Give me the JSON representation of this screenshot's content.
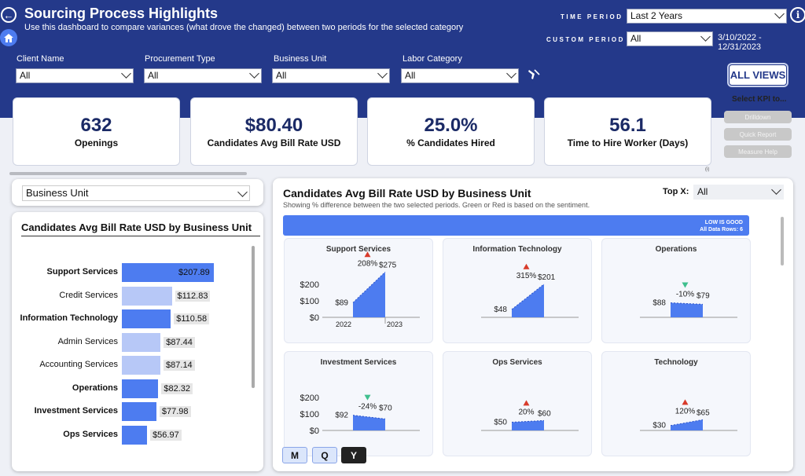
{
  "header": {
    "title": "Sourcing Process Highlights",
    "subtitle": "Use this dashboard to compare variances (what drove the changed) between two periods for the selected category",
    "time_period_label": "TIME PERIOD",
    "time_period_value": "Last 2 Years",
    "custom_period_label": "CUSTOM PERIOD",
    "custom_period_value": "All",
    "date_range": "3/10/2022 - 12/31/2023",
    "all_views": "ALL VIEWS"
  },
  "filters": [
    {
      "label": "Client Name",
      "value": "All"
    },
    {
      "label": "Procurement Type",
      "value": "All"
    },
    {
      "label": "Business Unit",
      "value": "All"
    },
    {
      "label": "Labor Category",
      "value": "All"
    }
  ],
  "kpis": [
    {
      "value": "632",
      "label": "Openings"
    },
    {
      "value": "$80.40",
      "label": "Candidates Avg Bill Rate USD"
    },
    {
      "value": "25.0%",
      "label": "% Candidates Hired"
    },
    {
      "value": "56.1",
      "label": "Time to Hire Worker (Days)"
    }
  ],
  "kpi_actions": {
    "title": "Select KPI to...",
    "buttons": [
      "Drilldown",
      "Quick Report",
      "Measure Help"
    ],
    "note": "(i)"
  },
  "left_panel": {
    "dimension_select": "Business Unit",
    "title": "Candidates Avg Bill Rate USD by Business Unit",
    "rows": [
      {
        "category": "Support Services",
        "value": 207.89,
        "label": "$207.89",
        "bold": true
      },
      {
        "category": "Credit Services",
        "value": 112.83,
        "label": "$112.83",
        "bold": false
      },
      {
        "category": "Information Technology",
        "value": 110.58,
        "label": "$110.58",
        "bold": true
      },
      {
        "category": "Admin Services",
        "value": 87.44,
        "label": "$87.44",
        "bold": false
      },
      {
        "category": "Accounting Services",
        "value": 87.14,
        "label": "$87.14",
        "bold": false
      },
      {
        "category": "Operations",
        "value": 82.32,
        "label": "$82.32",
        "bold": true
      },
      {
        "category": "Investment Services",
        "value": 77.98,
        "label": "$77.98",
        "bold": true
      },
      {
        "category": "Ops Services",
        "value": 56.97,
        "label": "$56.97",
        "bold": true
      }
    ],
    "colors": {
      "bold_bar": "#4d7cf0",
      "light_bar": "#b7c8f7"
    }
  },
  "right_panel": {
    "title": "Candidates Avg Bill Rate USD by Business Unit",
    "subtitle": "Showing % difference between the two selected periods. Green or Red is based on the sentiment.",
    "topx_label": "Top X:",
    "topx_value": "All",
    "banner_line1": "LOW IS GOOD",
    "banner_line2": "All Data Rows: 6",
    "period_buttons": [
      "M",
      "Q",
      "Y"
    ],
    "active_period": "Y"
  },
  "chart_data": {
    "type": "area",
    "y_ticks": [
      "$200",
      "$100",
      "$0"
    ],
    "x_ticks": [
      "2022",
      "2023"
    ],
    "ylim": [
      0,
      300
    ],
    "series": [
      {
        "name": "Support Services",
        "v2022": 89,
        "v2023": 275,
        "label_2022": "$89",
        "label_2023": "$275",
        "pct": "208%",
        "direction": "up",
        "show_y_axis": true,
        "show_x_axis": true
      },
      {
        "name": "Information Technology",
        "v2022": 48,
        "v2023": 201,
        "label_2022": "$48",
        "label_2023": "$201",
        "pct": "315%",
        "direction": "up",
        "show_y_axis": false,
        "show_x_axis": false
      },
      {
        "name": "Operations",
        "v2022": 88,
        "v2023": 79,
        "label_2022": "$88",
        "label_2023": "$79",
        "pct": "-10%",
        "direction": "down",
        "show_y_axis": false,
        "show_x_axis": false
      },
      {
        "name": "Investment Services",
        "v2022": 92,
        "v2023": 70,
        "label_2022": "$92",
        "label_2023": "$70",
        "pct": "-24%",
        "direction": "down",
        "show_y_axis": true,
        "show_x_axis": false
      },
      {
        "name": "Ops Services",
        "v2022": 50,
        "v2023": 60,
        "label_2022": "$50",
        "label_2023": "$60",
        "pct": "20%",
        "direction": "up",
        "show_y_axis": false,
        "show_x_axis": false
      },
      {
        "name": "Technology",
        "v2022": 30,
        "v2023": 65,
        "label_2022": "$30",
        "label_2023": "$65",
        "pct": "120%",
        "direction": "up",
        "show_y_axis": false,
        "show_x_axis": false
      }
    ],
    "colors": {
      "area": "#4d7cf0",
      "up": "#d83b2b",
      "down": "#3fbf8e"
    }
  }
}
